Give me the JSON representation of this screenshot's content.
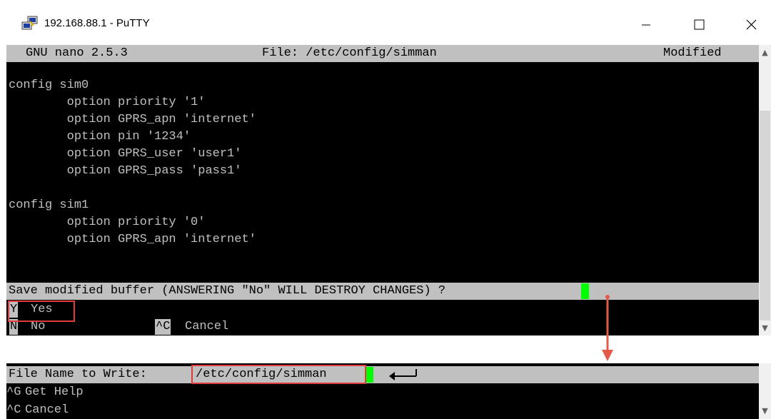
{
  "window": {
    "title": "192.168.88.1 - PuTTY",
    "controls": {
      "minimize": "—",
      "maximize": "☐",
      "close": "✕"
    }
  },
  "nano": {
    "header": {
      "version": "GNU nano 2.5.3",
      "file": "File: /etc/config/simman",
      "status": "Modified"
    },
    "lines": [
      "config sim0",
      "        option priority '1'",
      "        option GPRS_apn 'internet'",
      "        option pin '1234'",
      "        option GPRS_user 'user1'",
      "        option GPRS_pass 'pass1'",
      "",
      "config sim1",
      "        option priority '0'",
      "        option GPRS_apn 'internet'"
    ],
    "save_prompt": "Save modified buffer (ANSWERING \"No\" WILL DESTROY CHANGES) ? ",
    "options": [
      {
        "key": "Y",
        "label": "Yes"
      },
      {
        "key": "N",
        "label": "No"
      },
      {
        "key": "^C",
        "label": "Cancel"
      }
    ]
  },
  "write_prompt": {
    "label": "File Name to Write: ",
    "filename": "/etc/config/simman",
    "shortcuts": [
      {
        "key": "^G",
        "label": "Get Help"
      },
      {
        "key": "^C",
        "label": "Cancel"
      }
    ]
  },
  "colors": {
    "terminal_bg": "#000000",
    "terminal_fg": "#c0c0c0",
    "cursor": "#00ff00",
    "highlight_box": "#e03c3c",
    "arrow": "#e35a4a"
  }
}
